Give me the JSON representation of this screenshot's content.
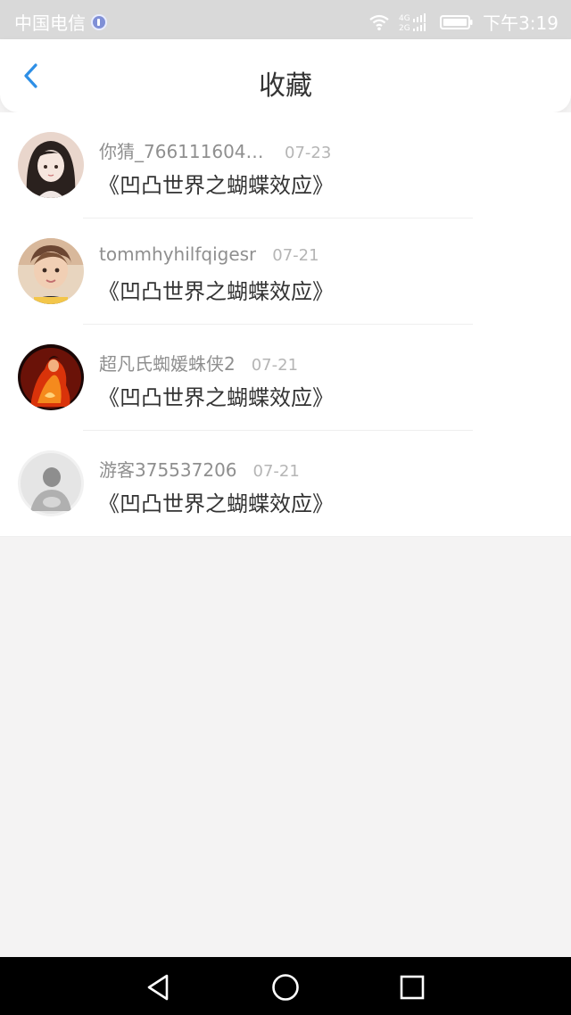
{
  "status_bar": {
    "carrier": "中国电信",
    "time": "下午3:19",
    "net_top": "4G",
    "net_bottom": "2G",
    "icons": [
      "music-app-icon",
      "wifi-icon",
      "signal-icon",
      "battery-icon"
    ]
  },
  "header": {
    "title": "收藏",
    "back_icon": "chevron-left-icon",
    "accent_color": "#2e8fe6"
  },
  "favorites": [
    {
      "username": "你猜_7661116046...",
      "date": "07-23",
      "title": "《凹凸世界之蝴蝶效应》",
      "avatar": "avatar-girl-illustration"
    },
    {
      "username": "tommhyhilfqigesr",
      "date": "07-21",
      "title": "《凹凸世界之蝴蝶效应》",
      "avatar": "avatar-child-photo"
    },
    {
      "username": "超凡氏蜘媛蛛侠2",
      "date": "07-21",
      "title": "《凹凸世界之蝴蝶效应》",
      "avatar": "avatar-fire-figure"
    },
    {
      "username": "游客375537206",
      "date": "07-21",
      "title": "《凹凸世界之蝴蝶效应》",
      "avatar": "avatar-default-gray"
    }
  ],
  "nav_bar": {
    "icons": [
      "nav-back-icon",
      "nav-home-icon",
      "nav-recent-icon"
    ]
  }
}
